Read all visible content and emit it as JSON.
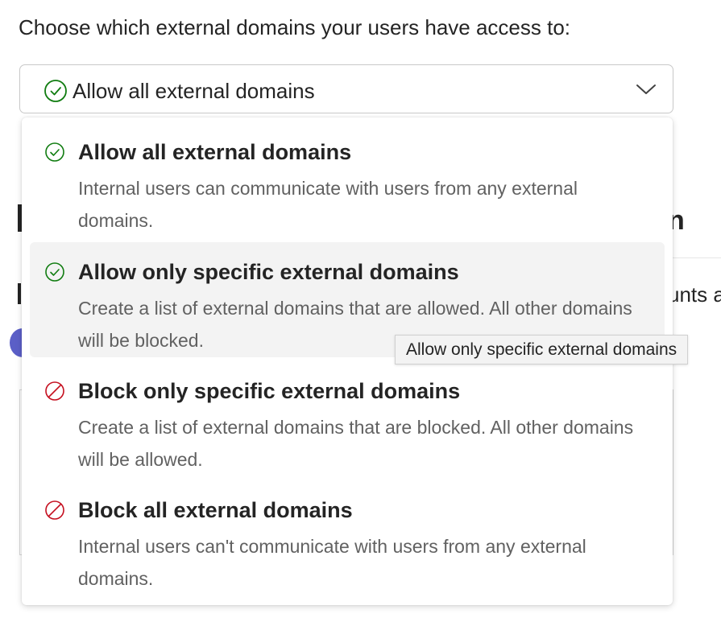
{
  "prompt": "Choose which external domains your users have access to:",
  "select": {
    "value": "Allow all external domains",
    "icon": "check-circle-icon",
    "chevron_icon": "chevron-down-icon",
    "border_color": "#c8c8c8"
  },
  "background": {
    "heading_fragment": "n",
    "text_fragment": "unts a"
  },
  "dropdown": {
    "options": [
      {
        "title": "Allow all external domains",
        "description": "Internal users can communicate with users from any external domains.",
        "icon": "check-circle-icon",
        "icon_color": "#107c10"
      },
      {
        "title": "Allow only specific external domains",
        "description": "Create a list of external domains that are allowed. All other domains will be blocked.",
        "icon": "check-circle-icon",
        "icon_color": "#107c10"
      },
      {
        "title": "Block only specific external domains",
        "description": "Create a list of external domains that are blocked. All other domains will be allowed.",
        "icon": "block-icon",
        "icon_color": "#c50f1f"
      },
      {
        "title": "Block all external domains",
        "description": "Internal users can't communicate with users from any external domains.",
        "icon": "block-icon",
        "icon_color": "#c50f1f"
      }
    ],
    "highlighted_color": "#f3f3f3"
  },
  "tooltip": {
    "text": "Allow only specific external domains"
  }
}
